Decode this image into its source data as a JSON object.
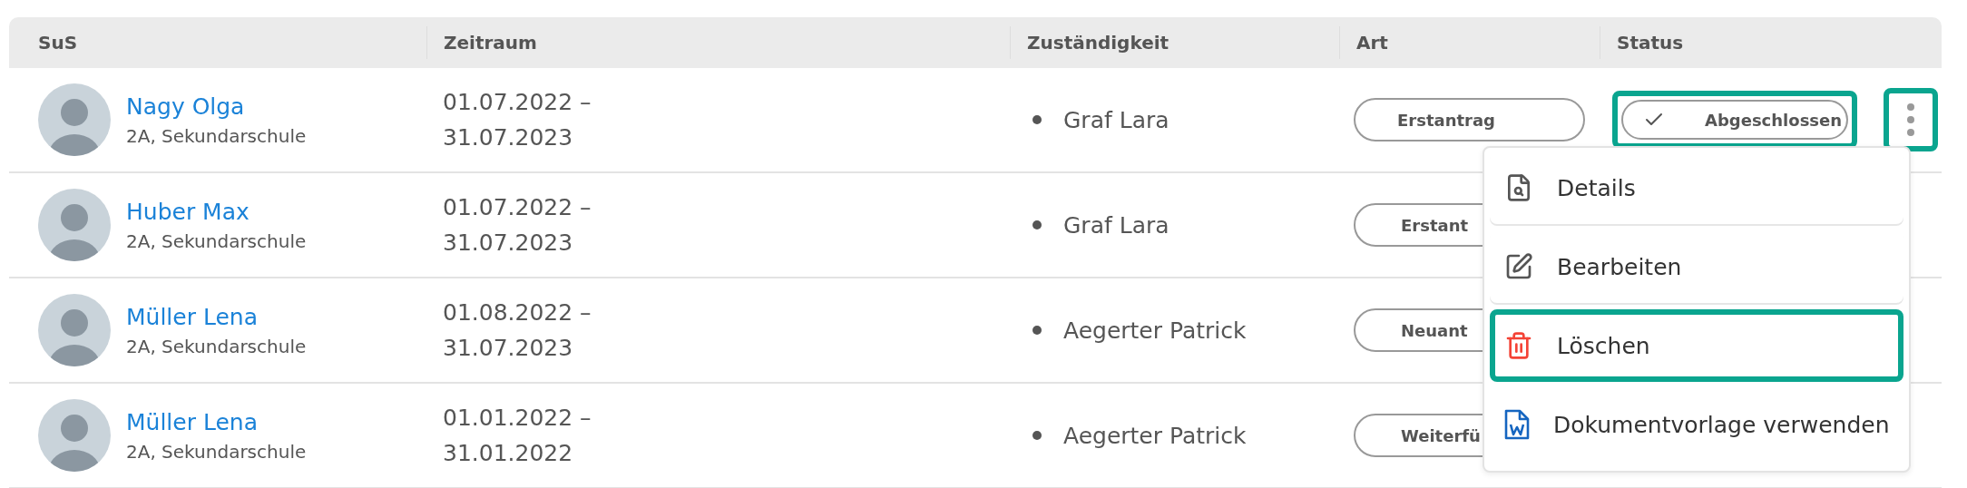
{
  "table": {
    "columns": [
      "SuS",
      "Zeitraum",
      "Zuständigkeit",
      "Art",
      "Status"
    ],
    "rows": [
      {
        "name": "Nagy Olga",
        "class": "2A, Sekundarschule",
        "period_start": "01.07.2022 –",
        "period_end": "31.07.2023",
        "responsible": "Graf Lara",
        "type": "Erstantrag",
        "status": "Abgeschlossen",
        "status_highlighted": true,
        "more_button": {
          "highlighted": true
        }
      },
      {
        "name": "Huber Max",
        "class": "2A, Sekundarschule",
        "period_start": "01.07.2022 –",
        "period_end": "31.07.2023",
        "responsible": "Graf Lara",
        "type": "Erstant"
      },
      {
        "name": "Müller Lena",
        "class": "2A, Sekundarschule",
        "period_start": "01.08.2022 –",
        "period_end": "31.07.2023",
        "responsible": "Aegerter Patrick",
        "type": "Neuant"
      },
      {
        "name": "Müller Lena",
        "class": "2A, Sekundarschule",
        "period_start": "01.01.2022 –",
        "period_end": "31.01.2022",
        "responsible": "Aegerter Patrick",
        "type": "Weiterfü"
      }
    ]
  },
  "context_menu": {
    "items": [
      {
        "label": "Details",
        "kind": "details",
        "highlighted": false
      },
      {
        "label": "Bearbeiten",
        "kind": "edit",
        "highlighted": false
      },
      {
        "label": "Löschen",
        "kind": "delete",
        "highlighted": true
      },
      {
        "label": "Dokumentvorlage verwenden",
        "kind": "word",
        "highlighted": false
      }
    ]
  }
}
